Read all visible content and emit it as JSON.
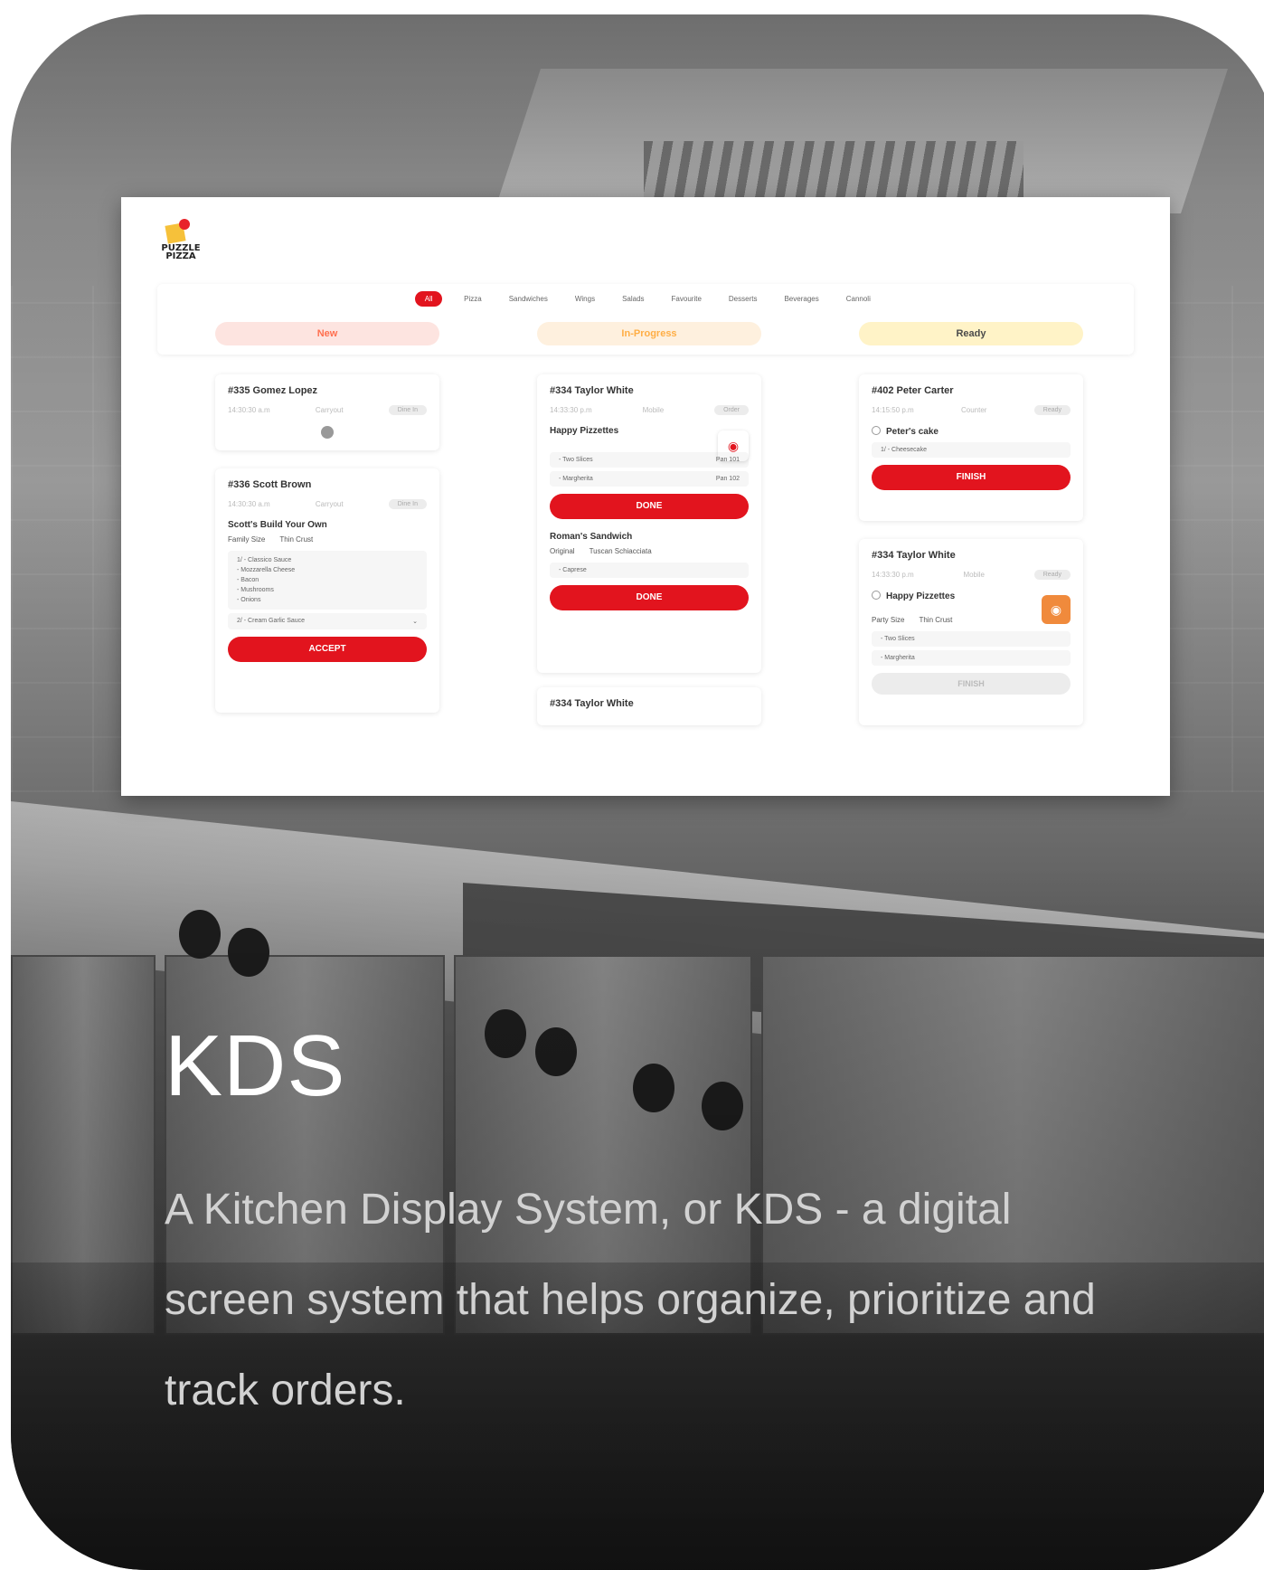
{
  "app": {
    "logo_text": "PUZZLE PIZZA",
    "filters": [
      "All",
      "Pizza",
      "Sandwiches",
      "Wings",
      "Salads",
      "Favourite",
      "Desserts",
      "Beverages",
      "Cannoli"
    ],
    "active_filter_index": 0,
    "columns": {
      "new": "New",
      "in_progress": "In-Progress",
      "ready": "Ready"
    },
    "tickets": {
      "t1": {
        "title": "#335 Gomez Lopez",
        "time": "14:30:30 a.m",
        "channel": "Carryout",
        "status": "Dine In"
      },
      "t2": {
        "title": "#336 Scott Brown",
        "time": "14:30:30 a.m",
        "channel": "Carryout",
        "status": "Dine In",
        "item": "Scott's Build Your Own",
        "mods": [
          "Family Size",
          "Thin Crust"
        ],
        "sub1_lines": [
          "1/ - Classico Sauce",
          "- Mozzarella Cheese",
          "- Bacon",
          "- Mushrooms",
          "- Onions"
        ],
        "sub2": "2/ - Cream Garlic Sauce",
        "action": "ACCEPT"
      },
      "t3": {
        "title": "#334 Taylor White",
        "time": "14:33:30 p.m",
        "channel": "Mobile",
        "status": "Order",
        "item1": "Happy Pizzettes",
        "sub1": [
          "- Two Slices",
          "Pan 101"
        ],
        "sub2": [
          "- Margherita",
          "Pan 102"
        ],
        "action1": "DONE",
        "item2": "Roman's Sandwich",
        "mods": [
          "Original",
          "Tuscan Schiacciata"
        ],
        "sub3": "- Caprese",
        "action2": "DONE"
      },
      "t4": {
        "title": "#334 Taylor White"
      },
      "t5": {
        "title": "#402 Peter Carter",
        "time": "14:15:50 p.m",
        "channel": "Counter",
        "status": "Ready",
        "item": "Peter's cake",
        "sub": "1/ - Cheesecake",
        "action": "FINISH"
      },
      "t6": {
        "title": "#334 Taylor White",
        "time": "14:33:30 p.m",
        "channel": "Mobile",
        "status": "Ready",
        "item": "Happy Pizzettes",
        "mods": [
          "Party Size",
          "Thin Crust"
        ],
        "sub1": "- Two Slices",
        "sub2": "- Margherita",
        "action": "FINISH"
      }
    }
  },
  "headline": "KDS",
  "description": "A Kitchen Display System, or KDS - a digital screen system that helps organize, prioritize and track orders.",
  "colors": {
    "accent": "#e2141e",
    "new": "#fde4e0",
    "in_progress": "#fef0de",
    "ready": "#fff3c7"
  },
  "icons": [
    "camera-icon",
    "pizza-thumbnail-icon",
    "clock-icon",
    "loading-icon"
  ]
}
